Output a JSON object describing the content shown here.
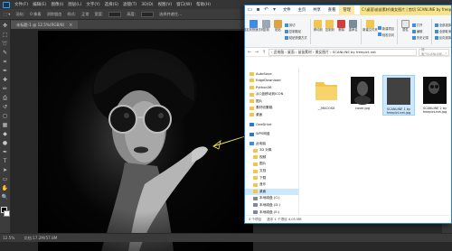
{
  "ps": {
    "menu": [
      "文件(F)",
      "编辑(E)",
      "图像(I)",
      "图层(L)",
      "文字(Y)",
      "选择(S)",
      "滤镜(T)",
      "3D(D)",
      "视图(V)",
      "窗口(W)",
      "帮助(H)"
    ],
    "options": {
      "feather_label": "羽化:",
      "feather_value": "0 像素",
      "antialias": "消除锯齿",
      "style_label": "样式:",
      "style_value": "正常",
      "width_label": "宽度:",
      "height_label": "高度:",
      "select_mask": "选择并遮住..."
    },
    "doc_tab": "未标题-1 @ 12.5%(RGB/8)",
    "tab_close": "×",
    "tools": [
      "move",
      "marquee",
      "lasso",
      "quick-select",
      "crop",
      "eyedropper",
      "heal",
      "brush",
      "stamp",
      "history",
      "eraser",
      "gradient",
      "blur",
      "dodge",
      "pen",
      "type",
      "path-select",
      "shape",
      "hand",
      "zoom"
    ],
    "tool_glyphs": [
      "✥",
      "⬚",
      "➰",
      "✎",
      "⌗",
      "✒",
      "✚",
      "✏",
      "⎙",
      "↺",
      "◻",
      "▦",
      "◆",
      "●",
      "✒",
      "T",
      "➤",
      "▭",
      "✋",
      "🔍"
    ],
    "status": {
      "zoom": "12.5%",
      "doc_info": "文档:17.2M/57.8M"
    }
  },
  "explorer": {
    "quick_access_icons": [
      "folder-icon",
      "save-icon",
      "undo-icon",
      "dropdown-icon"
    ],
    "ribbon_tabs": [
      "文件",
      "主页",
      "共享",
      "查看",
      "管理"
    ],
    "active_tab": "管理",
    "window_title": "C:\\桌面\\苗苗素材\\美女图片 | 剪切 SCANLINE by freepict.net",
    "ribbon_groups": {
      "clipboard": [
        "固定到快速访问",
        "复制",
        "粘贴"
      ],
      "clipboard_mini": [
        "剪切",
        "复制路径",
        "粘贴快捷方式"
      ],
      "organize": [
        "移动到",
        "复制到",
        "删除",
        "重命名"
      ],
      "new": [
        "新建文件夹"
      ],
      "new_mini": [
        "新建项目",
        "轻松访问"
      ],
      "open": [
        "属性"
      ],
      "open_mini": [
        "打开",
        "编辑",
        "历史记录"
      ],
      "select": [
        "全部选择",
        "全部取消",
        "反向选择"
      ]
    },
    "address": "› 此电脑 › 桌面 › 苗苗素材 › 美女图片 › SCANLINE by freepict.net",
    "search_placeholder": "搜索\"SCANLINE...\"",
    "nav": [
      {
        "label": "AutoSave",
        "icon": "folder",
        "indent": false
      },
      {
        "label": "EdgeDownload",
        "icon": "folder",
        "indent": false
      },
      {
        "label": "Python36",
        "icon": "folder",
        "indent": false
      },
      {
        "label": "从C盘移动到ICON",
        "icon": "folder",
        "indent": false
      },
      {
        "label": "图片",
        "icon": "folder",
        "indent": false
      },
      {
        "label": "素材收集箱",
        "icon": "folder",
        "indent": false
      },
      {
        "label": "桌面",
        "icon": "folder",
        "indent": false
      },
      {
        "label": "",
        "icon": "gap",
        "indent": false
      },
      {
        "label": "OneDrive",
        "icon": "cloud",
        "indent": false
      },
      {
        "label": "",
        "icon": "gap",
        "indent": false
      },
      {
        "label": "WPS网盘",
        "icon": "cloud",
        "indent": false
      },
      {
        "label": "",
        "icon": "gap",
        "indent": false
      },
      {
        "label": "此电脑",
        "icon": "pc",
        "indent": false
      },
      {
        "label": "3D 对象",
        "icon": "folder",
        "indent": true
      },
      {
        "label": "视频",
        "icon": "folder",
        "indent": true
      },
      {
        "label": "图片",
        "icon": "folder",
        "indent": true
      },
      {
        "label": "文档",
        "icon": "folder",
        "indent": true
      },
      {
        "label": "下载",
        "icon": "folder",
        "indent": true
      },
      {
        "label": "音乐",
        "icon": "folder",
        "indent": true
      },
      {
        "label": "桌面",
        "icon": "folder",
        "indent": true,
        "selected": true
      },
      {
        "label": "本地磁盘 (C:)",
        "icon": "drive",
        "indent": true
      },
      {
        "label": "本地磁盘 (D:)",
        "icon": "drive",
        "indent": true
      },
      {
        "label": "本地磁盘 (E:)",
        "icon": "drive",
        "indent": true
      },
      {
        "label": "",
        "icon": "gap",
        "indent": false
      },
      {
        "label": "网络",
        "icon": "net",
        "indent": false
      }
    ],
    "files": [
      {
        "name": "__MACOSX",
        "type": "folder"
      },
      {
        "name": "cover.jpg",
        "type": "image"
      },
      {
        "name": "SCANLINE 1 by freepict.net.jpg",
        "type": "image",
        "selected": true
      },
      {
        "name": "SCANLINE 2 by freepict.net.jpg",
        "type": "image"
      }
    ],
    "status": {
      "count": "4 个项目",
      "selected": "选中 1 个项目  4.05 MB"
    }
  },
  "colors": {
    "drag_line": "#e8e24a",
    "accent": "#1e7fd0"
  }
}
